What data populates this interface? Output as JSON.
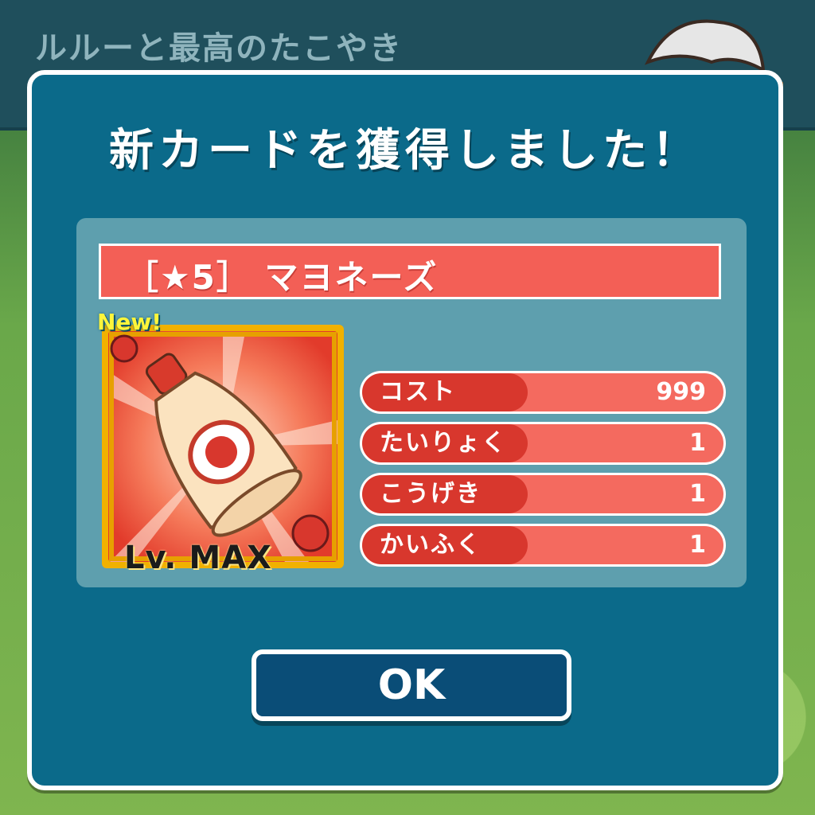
{
  "header": {
    "title": "ルルーと最高のたこやき"
  },
  "dialog": {
    "title": "新カードを獲得しました！",
    "card": {
      "name": "［★5］ マヨネーズ",
      "badge": "New!",
      "level": "Lv. MAX",
      "image_icon": "mayonnaise-bottle-icon"
    },
    "stats": [
      {
        "label": "コスト",
        "value": "999"
      },
      {
        "label": "たいりょく",
        "value": "1"
      },
      {
        "label": "こうげき",
        "value": "1"
      },
      {
        "label": "かいふく",
        "value": "1"
      }
    ],
    "ok_button": "OK"
  },
  "colors": {
    "dialog_bg": "#0b6a8a",
    "panel_bg": "#5e9fae",
    "name_bar": "#f35f56",
    "stat_label": "#d8372d",
    "stat_bar": "#f46a5f",
    "button_bg": "#0a4d77"
  }
}
